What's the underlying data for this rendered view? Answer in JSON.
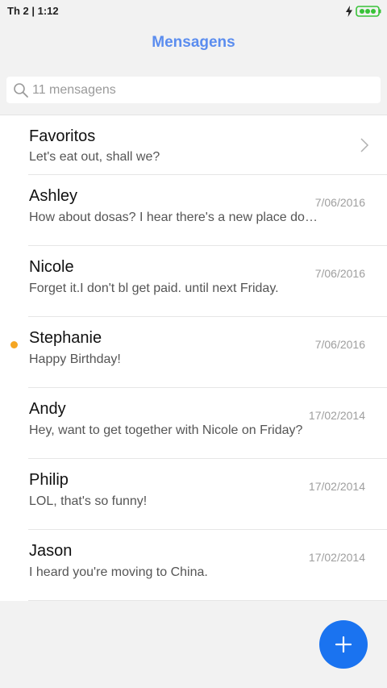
{
  "status_bar": {
    "time": "Th 2 | 1:12",
    "charging_icon": "bolt-icon",
    "battery_icon": "battery-icon",
    "battery_color": "#38c238"
  },
  "header": {
    "title": "Mensagens",
    "title_color": "#5b8def"
  },
  "search": {
    "placeholder": "11 mensagens",
    "icon": "search-icon"
  },
  "conversations": [
    {
      "name": "Favoritos",
      "preview": "Let's eat out, shall we?",
      "date": "",
      "chevron": true,
      "unread": false
    },
    {
      "name": "Ashley",
      "preview": "How about dosas? I hear there's a new place do…",
      "date": "7/06/2016",
      "unread": false
    },
    {
      "name": "Nicole",
      "preview": "Forget it.I don't bl get paid. until next Friday.",
      "date": "7/06/2016",
      "unread": false
    },
    {
      "name": "Stephanie",
      "preview": "Happy Birthday!",
      "date": "7/06/2016",
      "unread": true
    },
    {
      "name": "Andy",
      "preview": "Hey, want to get together with Nicole on Friday?",
      "date": "17/02/2014",
      "unread": false
    },
    {
      "name": "Philip",
      "preview": "LOL, that's so funny!",
      "date": "17/02/2014",
      "unread": false
    },
    {
      "name": "Jason",
      "preview": "I heard you're moving to China.",
      "date": "17/02/2014",
      "unread": false
    }
  ],
  "fab": {
    "icon": "plus-icon",
    "color": "#1a73f0"
  },
  "colors": {
    "unread_dot": "#f5a623",
    "background": "#f2f2f2"
  }
}
